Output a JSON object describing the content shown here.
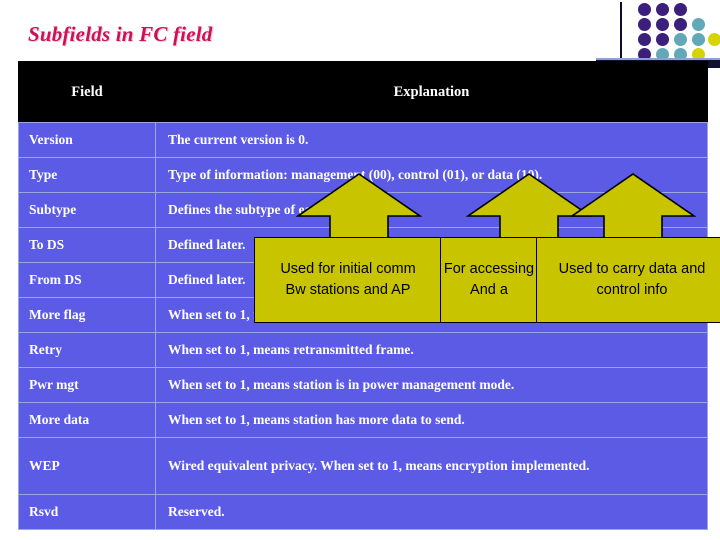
{
  "slide": {
    "title": "Subfields in FC field",
    "title_color": "#cc1155",
    "background_color": "#ffffff"
  },
  "decoration": {
    "name": "dot-grid",
    "colors": {
      "purple": "#3b1f7a",
      "teal": "#63a8b8",
      "yellow": "#d6d400",
      "bar": "#111133"
    }
  },
  "table": {
    "header_background": "#000000",
    "row_background": "#5b5be6",
    "row_text_color": "#ffffff",
    "border_color": "#9aa8e0",
    "columns": [
      "Field",
      "Explanation"
    ],
    "rows": [
      {
        "field": "Version",
        "explanation": "The current version is 0."
      },
      {
        "field": "Type",
        "explanation": "Type of information: management (00), control (01), or data (10)."
      },
      {
        "field": "Subtype",
        "explanation": "Defines the subtype of each type (see )."
      },
      {
        "field": "To DS",
        "explanation": "Defined later."
      },
      {
        "field": "From DS",
        "explanation": "Defined later."
      },
      {
        "field": "More flag",
        "explanation": "When set to 1, means more fragments."
      },
      {
        "field": "Retry",
        "explanation": "When set to 1, means retransmitted frame."
      },
      {
        "field": "Pwr mgt",
        "explanation": "When set to 1, means station is in power management mode."
      },
      {
        "field": "More data",
        "explanation": "When set to 1, means station has more data to send."
      },
      {
        "field": "WEP",
        "explanation": "Wired equivalent privacy. When set to 1, means encryption implemented."
      },
      {
        "field": "Rsvd",
        "explanation": "Reserved."
      }
    ]
  },
  "annotations": {
    "fill_color": "#c8c400",
    "border_color": "#000000",
    "text_color": "#000000",
    "callouts": [
      {
        "line1": "Used for initial comm",
        "line2": "Bw stations and AP"
      },
      {
        "line1": "For accessing",
        "line2": "And a"
      },
      {
        "line1": "Used to carry data and",
        "line2": "control info"
      }
    ],
    "arrow_count": 3
  }
}
